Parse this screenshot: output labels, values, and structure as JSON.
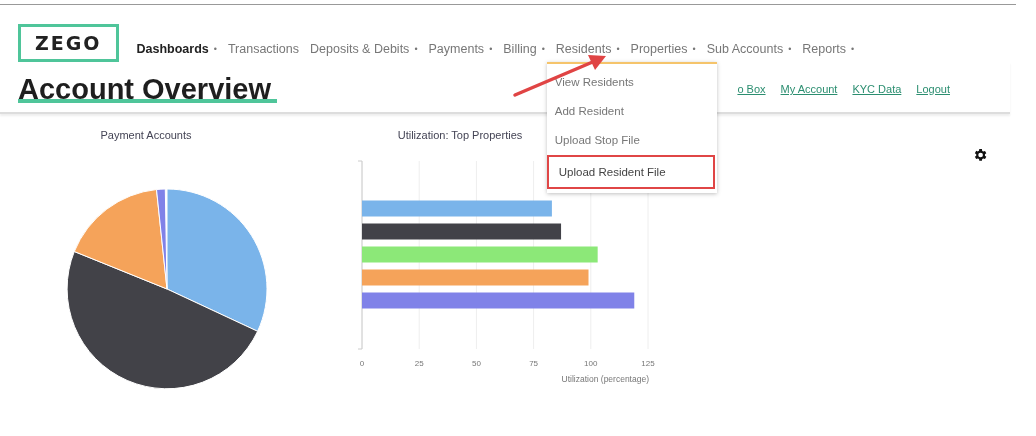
{
  "logo": {
    "text": "ZEGO"
  },
  "nav": [
    {
      "label": "Dashboards",
      "caret": "•",
      "selected": true
    },
    {
      "label": "Transactions",
      "selected": false
    },
    {
      "label": "Deposits & Debits",
      "caret": "•",
      "selected": false
    },
    {
      "label": "Payments",
      "caret": "•",
      "selected": false
    },
    {
      "label": "Billing",
      "caret": "•",
      "selected": false
    },
    {
      "label": "Residents",
      "caret": "•",
      "selected": false,
      "menu": [
        {
          "label": "View Residents",
          "highlighted": false
        },
        {
          "label": "Add Resident",
          "highlighted": false
        },
        {
          "label": "Upload Stop File",
          "highlighted": false
        },
        {
          "label": "Upload Resident File",
          "highlighted": true
        }
      ]
    },
    {
      "label": "Properties",
      "caret": "•",
      "selected": false
    },
    {
      "label": "Sub Accounts",
      "caret": "•",
      "selected": false
    },
    {
      "label": "Reports",
      "caret": "•",
      "selected": false
    }
  ],
  "page_title": "Account Overview",
  "header_links": [
    "o Box",
    "My Account",
    "KYC Data",
    "Logout"
  ],
  "pie_chart": {
    "title": "Payment Accounts"
  },
  "bar_chart": {
    "chart_data": {
      "type": "bar",
      "title": "Utilization: Top Properties",
      "orientation": "horizontal",
      "grid": true,
      "xlabel": "Utilization (percentage)",
      "xlim": [
        0,
        125
      ],
      "xticks": [
        0,
        25,
        50,
        75,
        100,
        125
      ],
      "values": [
        83,
        87,
        103,
        99,
        119
      ],
      "colors": [
        "#7ab4ea",
        "#424248",
        "#8ce878",
        "#f5a35a",
        "#8082e8"
      ]
    }
  }
}
